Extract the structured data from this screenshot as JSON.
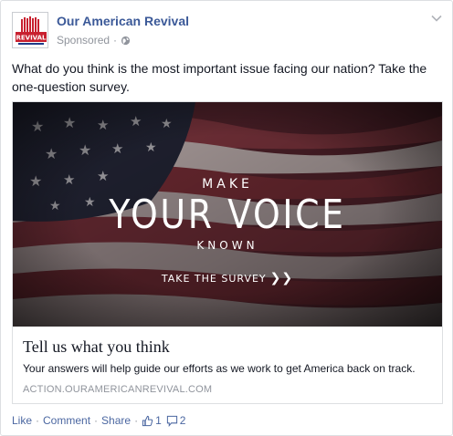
{
  "post": {
    "page_name": "Our American Revival",
    "sponsored_label": "Sponsored",
    "separator": "·",
    "message": "What do you think is the most important issue facing our nation? Take the one-question survey."
  },
  "avatar": {
    "logo_text": "REVIVAL"
  },
  "hero": {
    "line1": "MAKE",
    "line2": "YOUR VOICE",
    "line3": "KNOWN",
    "cta": "TAKE THE SURVEY",
    "cta_arrows": "❯❯"
  },
  "link": {
    "title": "Tell us what you think",
    "description": "Your answers will help guide our efforts as we work to get America back on track.",
    "domain": "ACTION.OURAMERICANREVIVAL.COM"
  },
  "footer": {
    "like": "Like",
    "comment": "Comment",
    "share": "Share",
    "separator": "·",
    "like_count": "1",
    "comment_count": "2"
  },
  "colors": {
    "link_blue": "#3b5998",
    "meta_gray": "#90949c",
    "border": "#dddfe2",
    "flag_red": "#7a2a33",
    "flag_blue": "#1f2236"
  },
  "icons": [
    "globe-icon",
    "chevron-down-icon",
    "thumbs-up-icon",
    "comment-icon"
  ]
}
